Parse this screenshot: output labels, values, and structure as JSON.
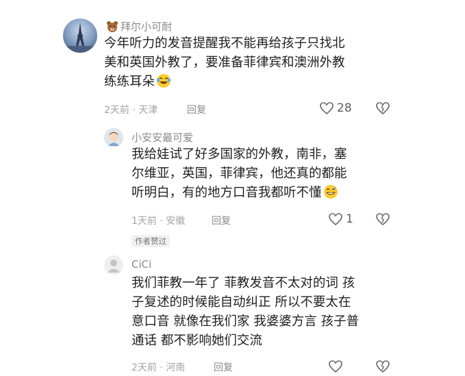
{
  "comments": [
    {
      "username": "拜尔小可耐",
      "text_lines": [
        "今年听力的发音提醒我不能再给孩子只找北",
        "美和英国外教了，要准备菲律宾和澳洲外教",
        "练练耳朵"
      ],
      "time_location": "2天前 · 天津",
      "reply_label": "回复",
      "like_count": "28",
      "username_emoji": "bear-emoji",
      "text_emoji": "laughing-tears-emoji"
    },
    {
      "username": "小安安最可爱",
      "text_lines": [
        "我给娃试了好多国家的外教，南非，塞",
        "尔维亚，英国，菲律宾，他还真的都能",
        "听明白，有的地方口音我都听不懂"
      ],
      "time_location": "1天前 · 安徽",
      "reply_label": "回复",
      "like_count": "1",
      "badge": "作者赞过",
      "text_emoji": "grin-sweat-emoji"
    },
    {
      "username": "CiCi",
      "text_lines": [
        "我们菲教一年了 菲教发音不太对的词 孩",
        "子复述的时候能自动纠正 所以不要太在",
        "意口音 就像在我们家 我婆婆方言 孩子普",
        "通话 都不影响她们交流"
      ],
      "time_location": "2天前 · 河南",
      "reply_label": "回复"
    }
  ],
  "colors": {
    "username": "#8a8a8a",
    "meta": "#a3a3a3",
    "text": "#1f1f1f"
  }
}
